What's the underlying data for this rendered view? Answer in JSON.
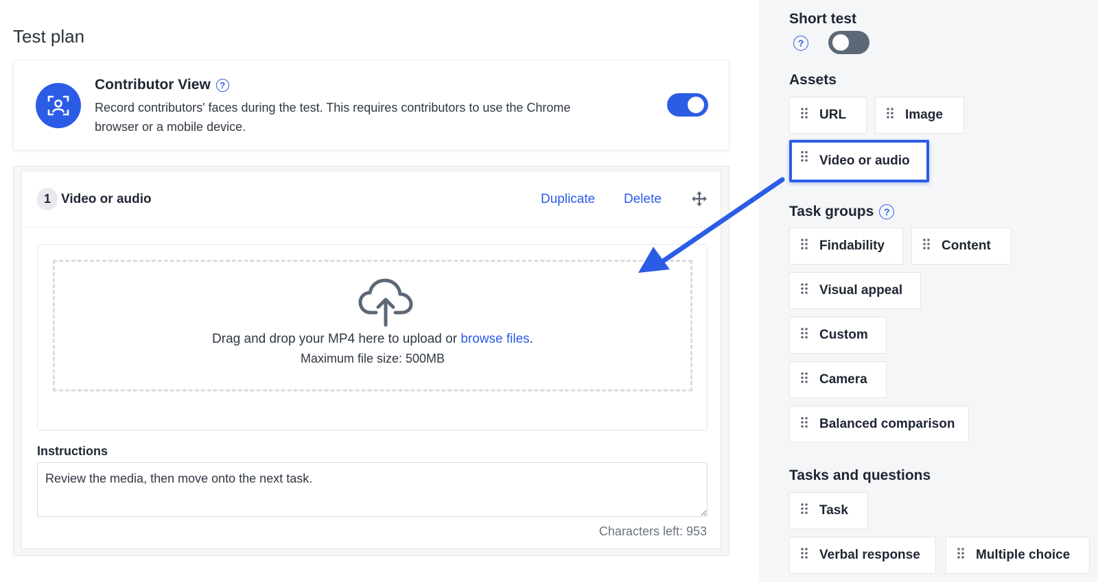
{
  "page": {
    "title": "Test plan"
  },
  "contributor_view": {
    "title": "Contributor View",
    "description": "Record contributors' faces during the test. This requires contributors to use the Chrome browser or a mobile device.",
    "help_glyph": "?",
    "toggle_on": true
  },
  "task": {
    "step_number": "1",
    "title": "Video or audio",
    "duplicate_label": "Duplicate",
    "delete_label": "Delete",
    "upload": {
      "text_before": "Drag and drop your MP4 here to upload or ",
      "browse_label": "browse files",
      "text_after": ".",
      "max_size": "Maximum file size: 500MB"
    },
    "instructions_label": "Instructions",
    "instructions_value": "Review the media, then move onto the next task.",
    "characters_left": "Characters left: 953"
  },
  "sidebar": {
    "short_test": {
      "title": "Short test",
      "help_glyph": "?",
      "toggle_on": false
    },
    "assets": {
      "title": "Assets",
      "items": [
        "URL",
        "Image",
        "Video or audio"
      ],
      "selected": "Video or audio"
    },
    "task_groups": {
      "title": "Task groups",
      "help_glyph": "?",
      "items": [
        "Findability",
        "Content",
        "Visual appeal",
        "Custom",
        "Camera",
        "Balanced comparison"
      ]
    },
    "tasks_and_questions": {
      "title": "Tasks and questions",
      "items": [
        "Task",
        "Verbal response",
        "Multiple choice"
      ]
    }
  },
  "colors": {
    "accent": "#2b5ce6",
    "sidebar_bg": "#f5f6f8",
    "toggle_off": "#5d6877"
  }
}
